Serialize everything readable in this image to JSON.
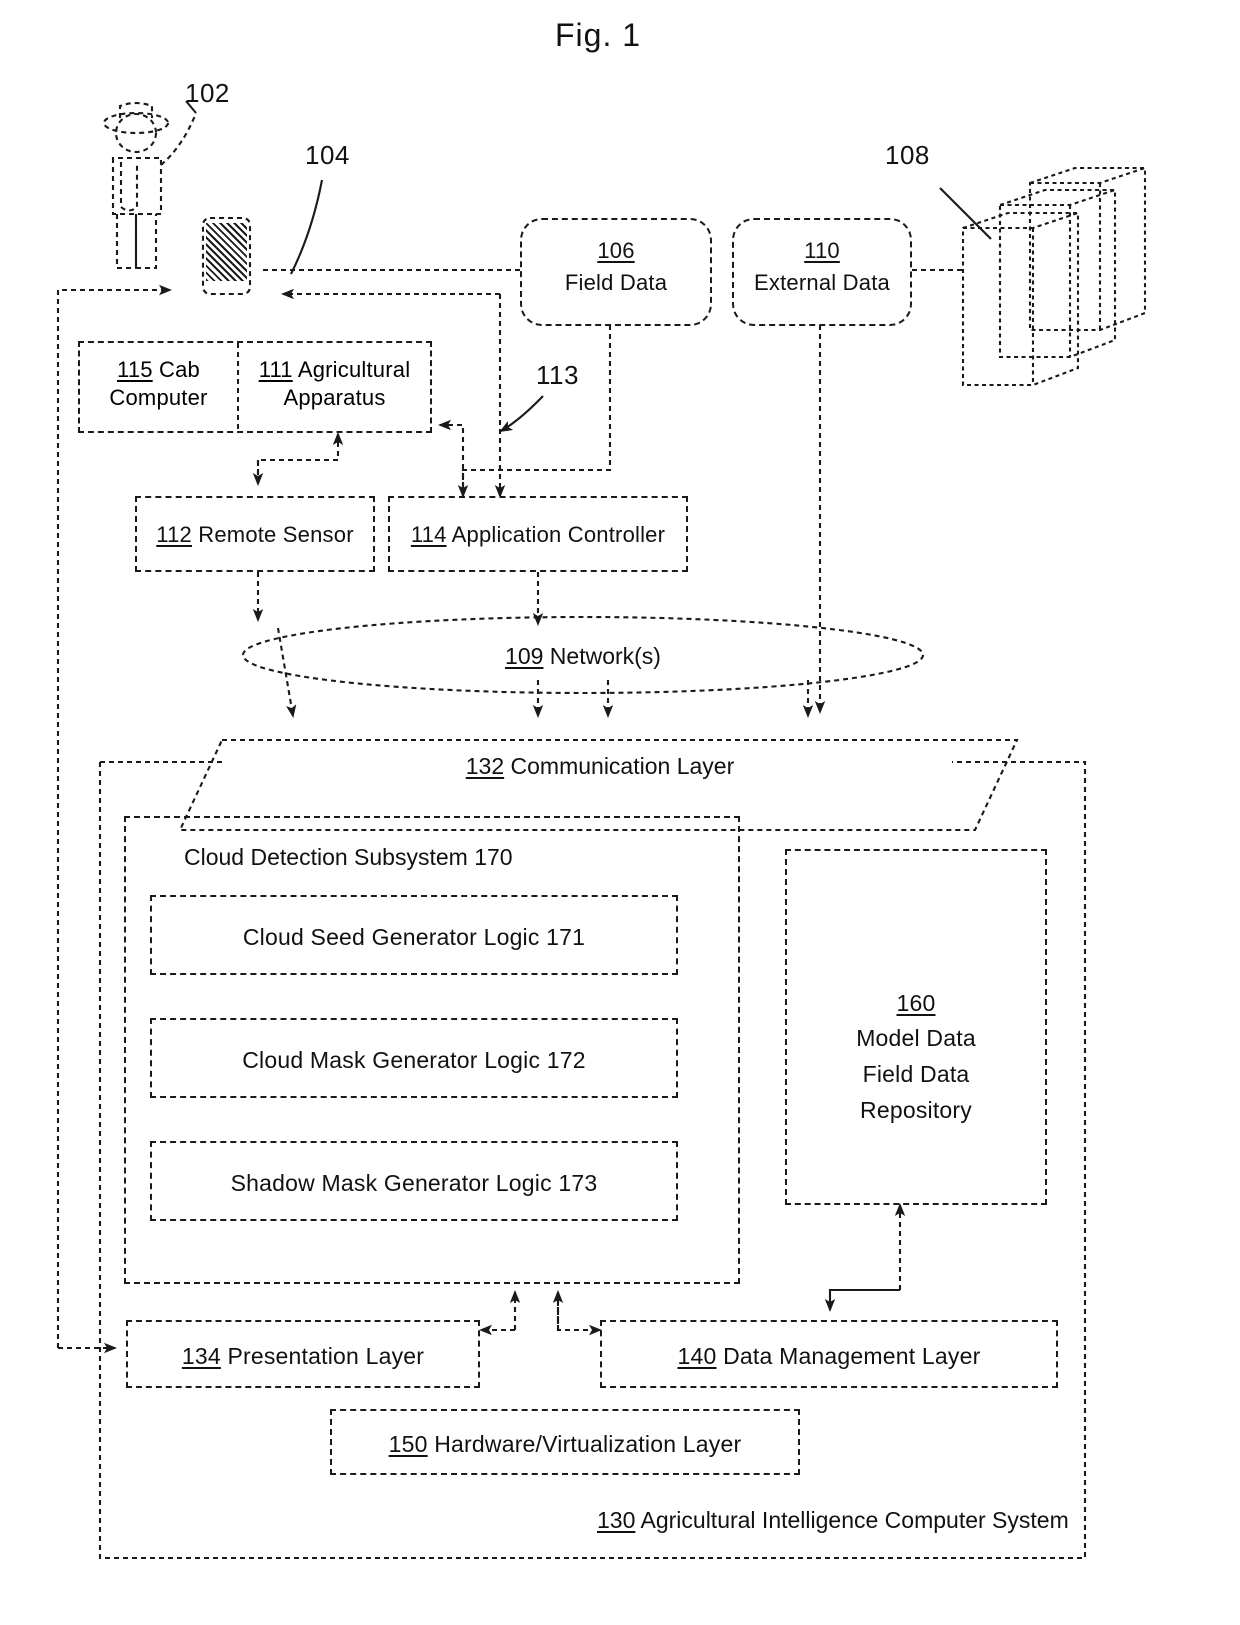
{
  "figure": {
    "title": "Fig. 1",
    "caption_number": "1"
  },
  "reference_numerals": {
    "user": "102",
    "mobile_device": "104",
    "server_stack": "108",
    "field_data_link": "113"
  },
  "nodes": {
    "field_data": {
      "num": "106",
      "label": "Field Data"
    },
    "external_data": {
      "num": "110",
      "label": "External Data"
    },
    "cab_computer": {
      "num": "115",
      "label": "Cab",
      "label2": "Computer"
    },
    "agricultural_apparatus": {
      "num": "111",
      "label": "Agricultural",
      "label2": "Apparatus"
    },
    "remote_sensor": {
      "num": "112",
      "label": "Remote Sensor"
    },
    "application_controller": {
      "num": "114",
      "label": "Application Controller"
    },
    "network": {
      "num": "109",
      "label": "Network(s)"
    },
    "communication_layer": {
      "num": "132",
      "label": "Communication Layer"
    },
    "cloud_detection_subsystem": {
      "label": "Cloud Detection Subsystem",
      "num": "170"
    },
    "cloud_seed_generator": {
      "label": "Cloud Seed Generator Logic",
      "num": "171"
    },
    "cloud_mask_generator": {
      "label": "Cloud Mask Generator Logic",
      "num": "172"
    },
    "shadow_mask_generator": {
      "label": "Shadow Mask Generator Logic",
      "num": "173"
    },
    "repository": {
      "num": "160",
      "line1": "Model Data",
      "line2": "Field Data",
      "line3": "Repository"
    },
    "presentation_layer": {
      "num": "134",
      "label": "Presentation Layer"
    },
    "data_management_layer": {
      "num": "140",
      "label": "Data Management Layer"
    },
    "hardware_virtualization_layer": {
      "num": "150",
      "label": "Hardware/Virtualization  Layer"
    },
    "agricultural_intelligence_system": {
      "num": "130",
      "label": "Agricultural Intelligence Computer System"
    }
  },
  "icons": {
    "user": "farmer-person-icon",
    "device": "mobile-device-icon",
    "servers": "server-stack-icon"
  },
  "colors": {
    "stroke": "#1a1a1a",
    "background": "#ffffff"
  }
}
